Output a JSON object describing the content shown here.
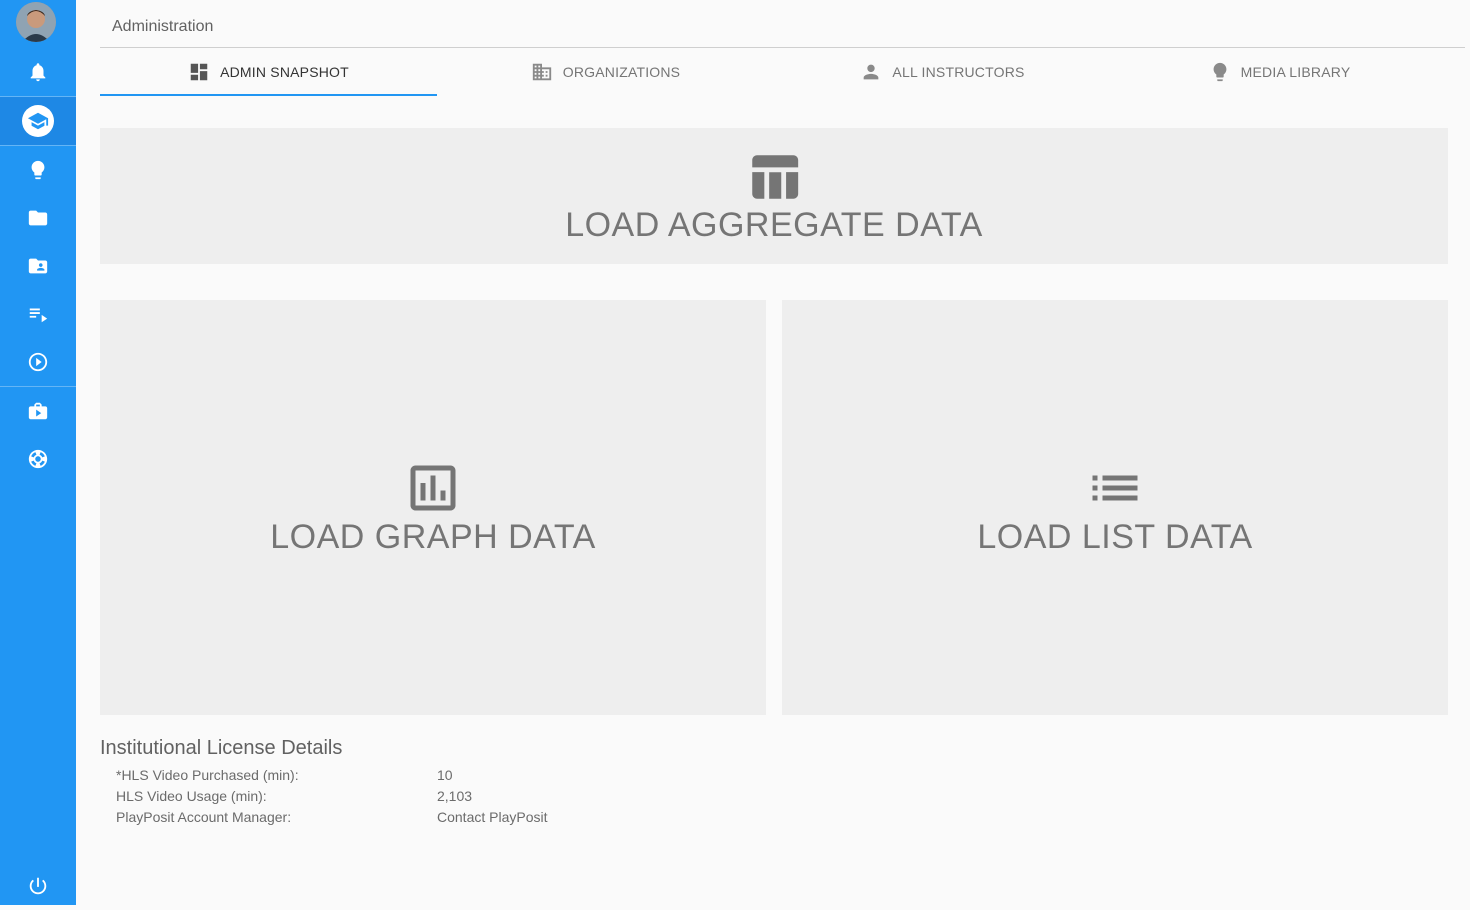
{
  "header": {
    "title": "Administration"
  },
  "tabs": [
    {
      "label": "ADMIN SNAPSHOT",
      "icon": "dashboard-icon",
      "active": true
    },
    {
      "label": "ORGANIZATIONS",
      "icon": "building-icon",
      "active": false
    },
    {
      "label": "ALL INSTRUCTORS",
      "icon": "person-icon",
      "active": false
    },
    {
      "label": "MEDIA LIBRARY",
      "icon": "lightbulb-icon",
      "active": false
    }
  ],
  "sidebar": {
    "items": [
      {
        "icon": "notifications-icon"
      },
      {
        "icon": "school-icon",
        "active": true
      },
      {
        "icon": "lightbulb-icon"
      },
      {
        "icon": "folder-icon"
      },
      {
        "icon": "shared-folder-icon"
      },
      {
        "icon": "playlist-icon"
      },
      {
        "icon": "play-circle-icon"
      },
      {
        "icon": "video-briefcase-icon"
      },
      {
        "icon": "support-icon"
      },
      {
        "icon": "power-icon"
      }
    ]
  },
  "cards": {
    "aggregate": "LOAD AGGREGATE DATA",
    "graph": "LOAD GRAPH DATA",
    "list": "LOAD LIST DATA"
  },
  "license": {
    "title": "Institutional License Details",
    "rows": [
      {
        "key": "*HLS Video Purchased (min):",
        "value": "10"
      },
      {
        "key": "HLS Video Usage (min):",
        "value": "2,103"
      },
      {
        "key": "PlayPosit Account Manager:",
        "value": "Contact PlayPosit"
      }
    ]
  },
  "colors": {
    "primary": "#2196f3",
    "card_bg": "#eeeeee",
    "text": "#757575"
  }
}
